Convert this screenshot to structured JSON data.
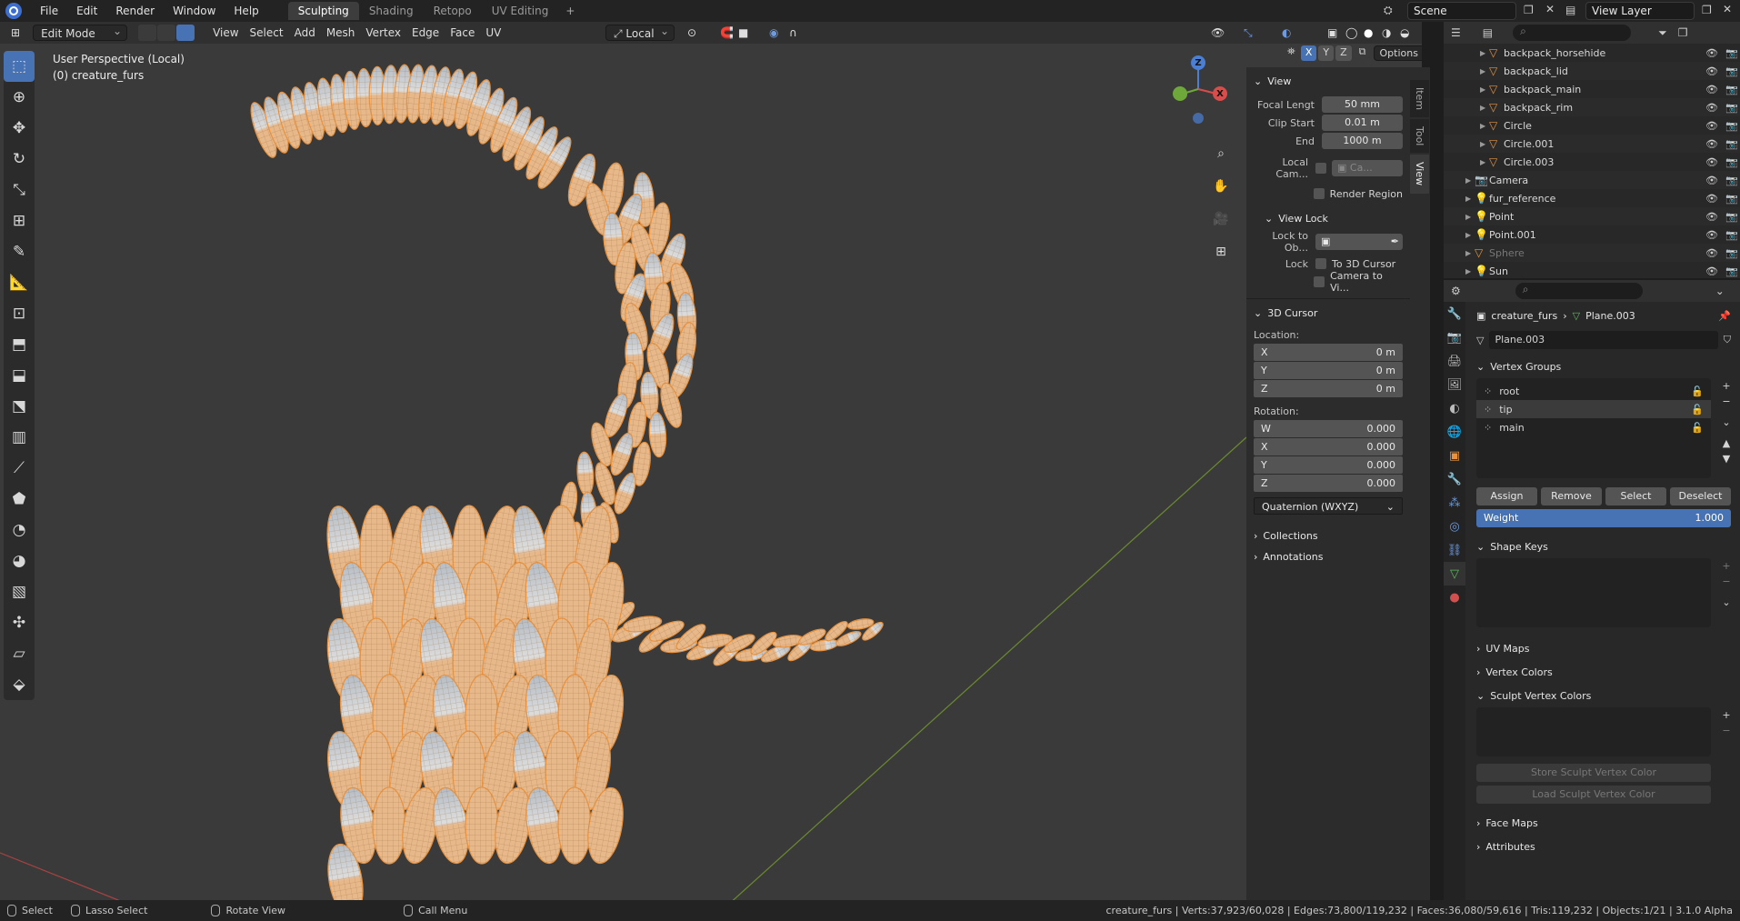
{
  "menubar": {
    "items": [
      "File",
      "Edit",
      "Render",
      "Window",
      "Help"
    ],
    "workspaces": [
      "Sculpting",
      "Shading",
      "Retopo",
      "UV Editing"
    ],
    "active_workspace": "Sculpting",
    "add_symbol": "+",
    "scene": "Scene",
    "view_layer": "View Layer"
  },
  "viewport_header": {
    "mode": "Edit Mode",
    "menus": [
      "View",
      "Select",
      "Add",
      "Mesh",
      "Vertex",
      "Edge",
      "Face",
      "UV"
    ],
    "transform_orientation": "Local",
    "axes": [
      "X",
      "Y",
      "Z"
    ],
    "options": "Options"
  },
  "viewport": {
    "perspective": "User Perspective (Local)",
    "object_label": "(0) creature_furs",
    "gizmo": {
      "z": "Z",
      "x": "X",
      "y": "Y"
    }
  },
  "npanel": {
    "tabs": [
      "Item",
      "Tool",
      "View"
    ],
    "active_tab": "View",
    "view": {
      "title": "View",
      "focal_label": "Focal Lengt",
      "focal_value": "50 mm",
      "clip_start_label": "Clip Start",
      "clip_start_value": "0.01 m",
      "end_label": "End",
      "end_value": "1000 m",
      "local_cam_label": "Local Cam...",
      "local_cam_value": "Ca...",
      "render_region": "Render Region"
    },
    "view_lock": {
      "title": "View Lock",
      "lock_to_obj_label": "Lock to Ob...",
      "lock_label": "Lock",
      "to_3d_cursor": "To 3D Cursor",
      "camera_to_view": "Camera to Vi..."
    },
    "cursor": {
      "title": "3D Cursor",
      "location_label": "Location:",
      "loc": [
        {
          "axis": "X",
          "value": "0 m"
        },
        {
          "axis": "Y",
          "value": "0 m"
        },
        {
          "axis": "Z",
          "value": "0 m"
        }
      ],
      "rotation_label": "Rotation:",
      "rot": [
        {
          "axis": "W",
          "value": "0.000"
        },
        {
          "axis": "X",
          "value": "0.000"
        },
        {
          "axis": "Y",
          "value": "0.000"
        },
        {
          "axis": "Z",
          "value": "0.000"
        }
      ],
      "rotation_mode": "Quaternion (WXYZ)"
    },
    "collections": "Collections",
    "annotations": "Annotations"
  },
  "outliner": {
    "rows": [
      {
        "name": "backpack_horsehide",
        "type": "mesh"
      },
      {
        "name": "backpack_lid",
        "type": "mesh"
      },
      {
        "name": "backpack_main",
        "type": "mesh"
      },
      {
        "name": "backpack_rim",
        "type": "mesh"
      },
      {
        "name": "Circle",
        "type": "mesh"
      },
      {
        "name": "Circle.001",
        "type": "mesh"
      },
      {
        "name": "Circle.003",
        "type": "mesh"
      },
      {
        "name": "Camera",
        "type": "camera"
      },
      {
        "name": "fur_reference",
        "type": "light"
      },
      {
        "name": "Point",
        "type": "light"
      },
      {
        "name": "Point.001",
        "type": "light"
      },
      {
        "name": "Sphere",
        "type": "mesh"
      },
      {
        "name": "Sun",
        "type": "light"
      }
    ]
  },
  "properties": {
    "breadcrumb_object": "creature_furs",
    "breadcrumb_data": "Plane.003",
    "data_name": "Plane.003",
    "vertex_groups": {
      "title": "Vertex Groups",
      "items": [
        "root",
        "tip",
        "main"
      ],
      "selected": "tip",
      "buttons": [
        "Assign",
        "Remove",
        "Select",
        "Deselect"
      ],
      "weight_label": "Weight",
      "weight_value": "1.000"
    },
    "shape_keys": "Shape Keys",
    "uv_maps": "UV Maps",
    "vertex_colors": "Vertex Colors",
    "sculpt_vertex_colors": "Sculpt Vertex Colors",
    "store_color": "Store Sculpt Vertex Color",
    "load_color": "Load Sculpt Vertex Color",
    "face_maps": "Face Maps",
    "attributes": "Attributes"
  },
  "statusbar": {
    "select": "Select",
    "lasso": "Lasso Select",
    "rotate": "Rotate View",
    "call_menu": "Call Menu",
    "stats": "creature_furs | Verts:37,923/60,028 | Edges:73,800/119,232 | Faces:36,080/59,616 | Tris:119,232 | Objects:1/21 | 3.1.0 Alpha"
  },
  "colors": {
    "accent": "#4772b3",
    "object_orange": "#e8923f",
    "fur_fill": "#e7b88a",
    "fur_tip": "#b4bcc4"
  }
}
